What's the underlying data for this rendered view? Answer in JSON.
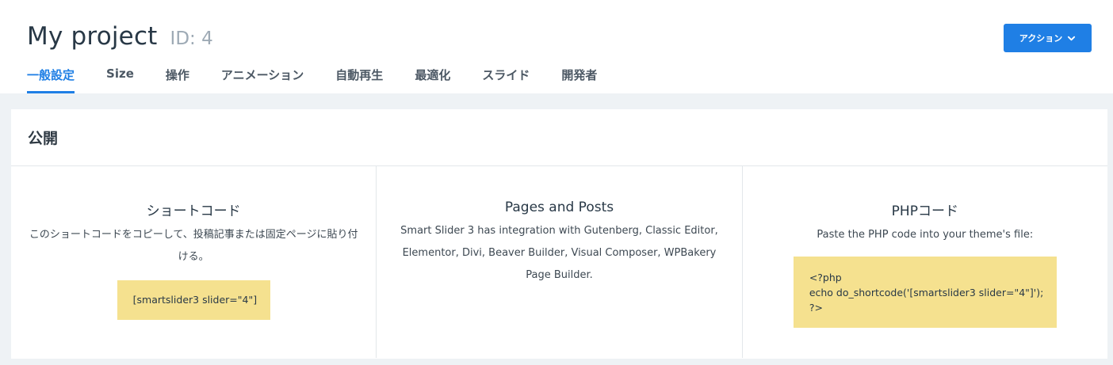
{
  "header": {
    "title": "My project",
    "id_label": "ID: 4",
    "action_label": "アクション"
  },
  "tabs": [
    {
      "label": "一般設定",
      "active": true
    },
    {
      "label": "Size"
    },
    {
      "label": "操作"
    },
    {
      "label": "アニメーション"
    },
    {
      "label": "自動再生"
    },
    {
      "label": "最適化"
    },
    {
      "label": "スライド"
    },
    {
      "label": "開発者"
    }
  ],
  "publish": {
    "title": "公開",
    "shortcode": {
      "title": "ショートコード",
      "desc": "このショートコードをコピーして、投稿記事または固定ページに貼り付ける。",
      "code": "[smartslider3 slider=\"4\"]"
    },
    "pages": {
      "title": "Pages and Posts",
      "desc": "Smart Slider 3 has integration with Gutenberg, Classic Editor, Elementor, Divi, Beaver Builder, Visual Composer, WPBakery Page Builder."
    },
    "php": {
      "title": "PHPコード",
      "desc": "Paste the PHP code into your theme's file:",
      "code_lines": [
        "<?php",
        "echo do_shortcode('[smartslider3 slider=\"4\"]');",
        "?>"
      ]
    }
  },
  "colors": {
    "accent": "#1f7fe5",
    "code_bg": "#f5e18f",
    "page_bg": "#eef2f5"
  }
}
